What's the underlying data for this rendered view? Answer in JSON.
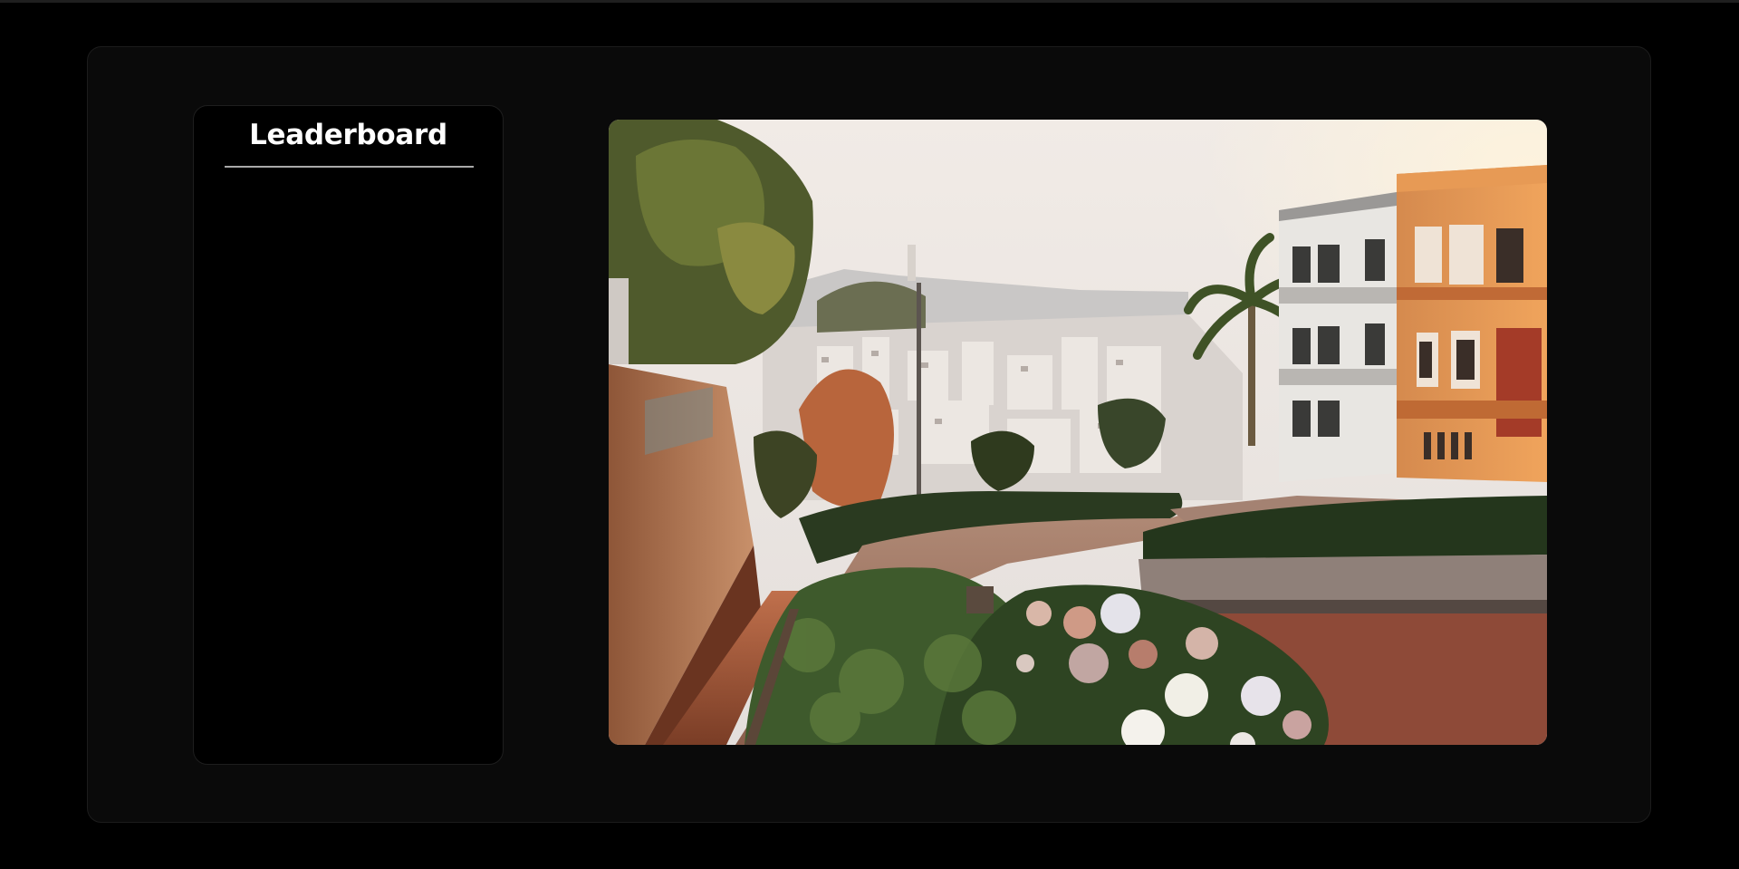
{
  "leaderboard": {
    "title": "Leaderboard",
    "entries": []
  },
  "hero_image": {
    "icon": "city-street-photo",
    "alt": ""
  },
  "colors": {
    "page_background": "#000000",
    "frame_background": "#0a0a0a",
    "panel_background": "#000000",
    "title_text": "#ffffff",
    "divider": "#a9a9a9"
  }
}
